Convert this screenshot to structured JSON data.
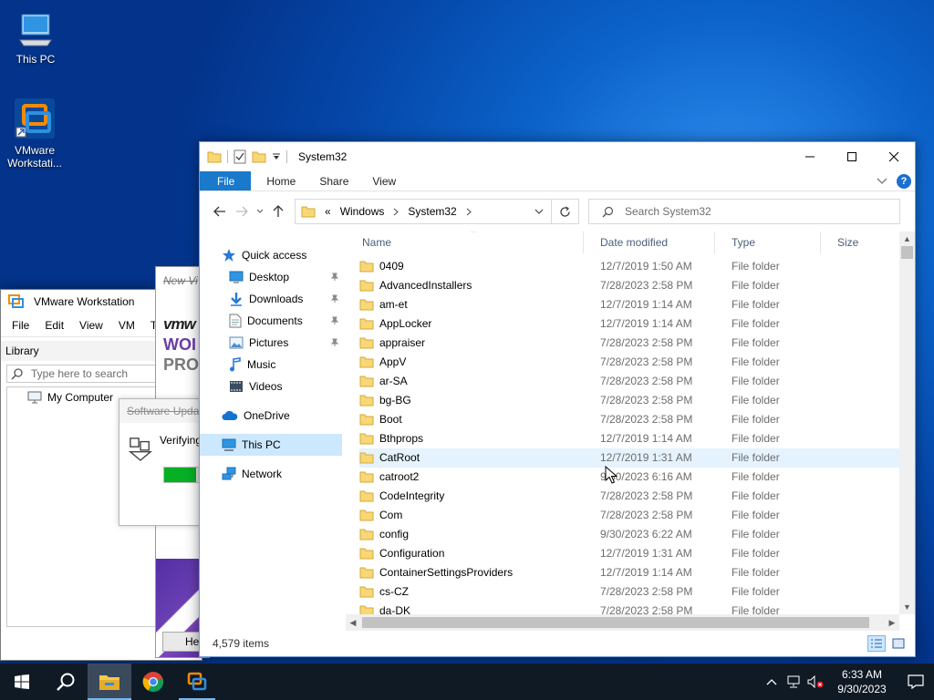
{
  "desktop": {
    "icons": [
      {
        "label": "This PC",
        "icon": "this-pc-icon"
      },
      {
        "label": "VMware Workstati...",
        "icon": "vmware-workstation-icon"
      }
    ]
  },
  "vmware": {
    "title": "VMware Workstation",
    "menu": [
      "File",
      "Edit",
      "View",
      "VM",
      "Ta"
    ],
    "library_label": "Library",
    "search_placeholder": "Type here to search",
    "tree_item": "My Computer",
    "splash": {
      "new_label": "New Vi",
      "brand1": "vmw",
      "brand2": "WOI",
      "brand3": "PRO",
      "help_label": "Hel"
    },
    "update_dialog": {
      "title": "Software Upda",
      "status": "Verifying",
      "progress_fraction": 0.6
    }
  },
  "explorer": {
    "title": "System32",
    "ribbon_tabs": [
      "File",
      "Home",
      "Share",
      "View"
    ],
    "help_glyph": "?",
    "address": {
      "overflow": "«",
      "crumbs": [
        "Windows",
        "System32"
      ]
    },
    "search_placeholder": "Search System32",
    "nav": [
      {
        "label": "Quick access",
        "icon": "star-icon",
        "pinned": false
      },
      {
        "label": "Desktop",
        "icon": "desktop-icon",
        "pinned": true
      },
      {
        "label": "Downloads",
        "icon": "downloads-icon",
        "pinned": true
      },
      {
        "label": "Documents",
        "icon": "documents-icon",
        "pinned": true
      },
      {
        "label": "Pictures",
        "icon": "pictures-icon",
        "pinned": true
      },
      {
        "label": "Music",
        "icon": "music-icon",
        "pinned": false
      },
      {
        "label": "Videos",
        "icon": "videos-icon",
        "pinned": false
      },
      {
        "label": "OneDrive",
        "icon": "cloud-icon",
        "pinned": false
      },
      {
        "label": "This PC",
        "icon": "this-pc-icon",
        "pinned": false,
        "selected": true
      },
      {
        "label": "Network",
        "icon": "network-icon",
        "pinned": false
      }
    ],
    "columns": [
      "Name",
      "Date modified",
      "Type",
      "Size"
    ],
    "files": [
      {
        "name": "0409",
        "date": "12/7/2019 1:50 AM",
        "type": "File folder"
      },
      {
        "name": "AdvancedInstallers",
        "date": "7/28/2023 2:58 PM",
        "type": "File folder"
      },
      {
        "name": "am-et",
        "date": "12/7/2019 1:14 AM",
        "type": "File folder"
      },
      {
        "name": "AppLocker",
        "date": "12/7/2019 1:14 AM",
        "type": "File folder"
      },
      {
        "name": "appraiser",
        "date": "7/28/2023 2:58 PM",
        "type": "File folder"
      },
      {
        "name": "AppV",
        "date": "7/28/2023 2:58 PM",
        "type": "File folder"
      },
      {
        "name": "ar-SA",
        "date": "7/28/2023 2:58 PM",
        "type": "File folder"
      },
      {
        "name": "bg-BG",
        "date": "7/28/2023 2:58 PM",
        "type": "File folder"
      },
      {
        "name": "Boot",
        "date": "7/28/2023 2:58 PM",
        "type": "File folder"
      },
      {
        "name": "Bthprops",
        "date": "12/7/2019 1:14 AM",
        "type": "File folder"
      },
      {
        "name": "CatRoot",
        "date": "12/7/2019 1:31 AM",
        "type": "File folder",
        "hover": true
      },
      {
        "name": "catroot2",
        "date": "9/30/2023 6:16 AM",
        "type": "File folder"
      },
      {
        "name": "CodeIntegrity",
        "date": "7/28/2023 2:58 PM",
        "type": "File folder"
      },
      {
        "name": "Com",
        "date": "7/28/2023 2:58 PM",
        "type": "File folder"
      },
      {
        "name": "config",
        "date": "9/30/2023 6:22 AM",
        "type": "File folder"
      },
      {
        "name": "Configuration",
        "date": "12/7/2019 1:31 AM",
        "type": "File folder"
      },
      {
        "name": "ContainerSettingsProviders",
        "date": "12/7/2019 1:14 AM",
        "type": "File folder"
      },
      {
        "name": "cs-CZ",
        "date": "7/28/2023 2:58 PM",
        "type": "File folder"
      },
      {
        "name": "da-DK",
        "date": "7/28/2023 2:58 PM",
        "type": "File folder"
      }
    ],
    "status_text": "4,579 items"
  },
  "taskbar": {
    "apps": [
      "start-icon",
      "search-icon",
      "file-explorer-icon",
      "chrome-icon",
      "vmware-workstation-icon"
    ],
    "time": "6:33 AM",
    "date": "9/30/2023"
  },
  "colors": {
    "accent": "#1979ca",
    "selection": "#cce8ff",
    "hover": "#e5f3ff",
    "taskbar": "#101a25",
    "folder": "#f6c94c"
  }
}
